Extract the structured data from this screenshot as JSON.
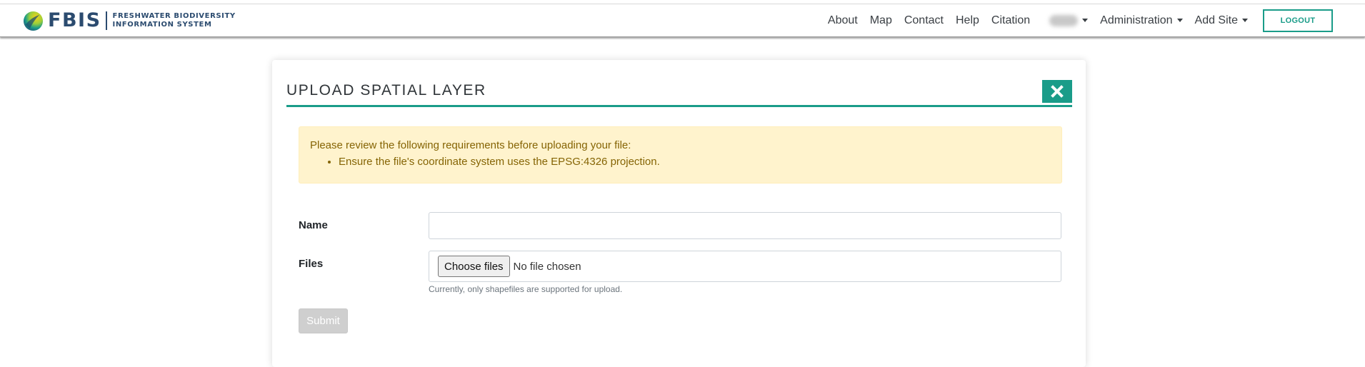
{
  "brand": {
    "name": "FBIS",
    "subtitle_line1": "FRESHWATER BIODIVERSITY",
    "subtitle_line2": "INFORMATION SYSTEM"
  },
  "nav": {
    "about": "About",
    "map": "Map",
    "contact": "Contact",
    "help": "Help",
    "citation": "Citation",
    "administration": "Administration",
    "add_site": "Add Site",
    "logout": "LOGOUT"
  },
  "page": {
    "title": "UPLOAD SPATIAL LAYER",
    "alert_intro": "Please review the following requirements before uploading your file:",
    "alert_items": [
      "Ensure the file's coordinate system uses the EPSG:4326 projection."
    ],
    "name_label": "Name",
    "name_value": "",
    "files_label": "Files",
    "choose_files": "Choose files",
    "no_file": "No file chosen",
    "files_help": "Currently, only shapefiles are supported for upload.",
    "submit": "Submit"
  },
  "colors": {
    "accent": "#1a9c89",
    "brand_text": "#2b4b6f",
    "alert_bg": "#fff3cd",
    "alert_text": "#856404"
  },
  "icons": {
    "close": "close-icon",
    "logo": "fbis-logo-icon"
  }
}
